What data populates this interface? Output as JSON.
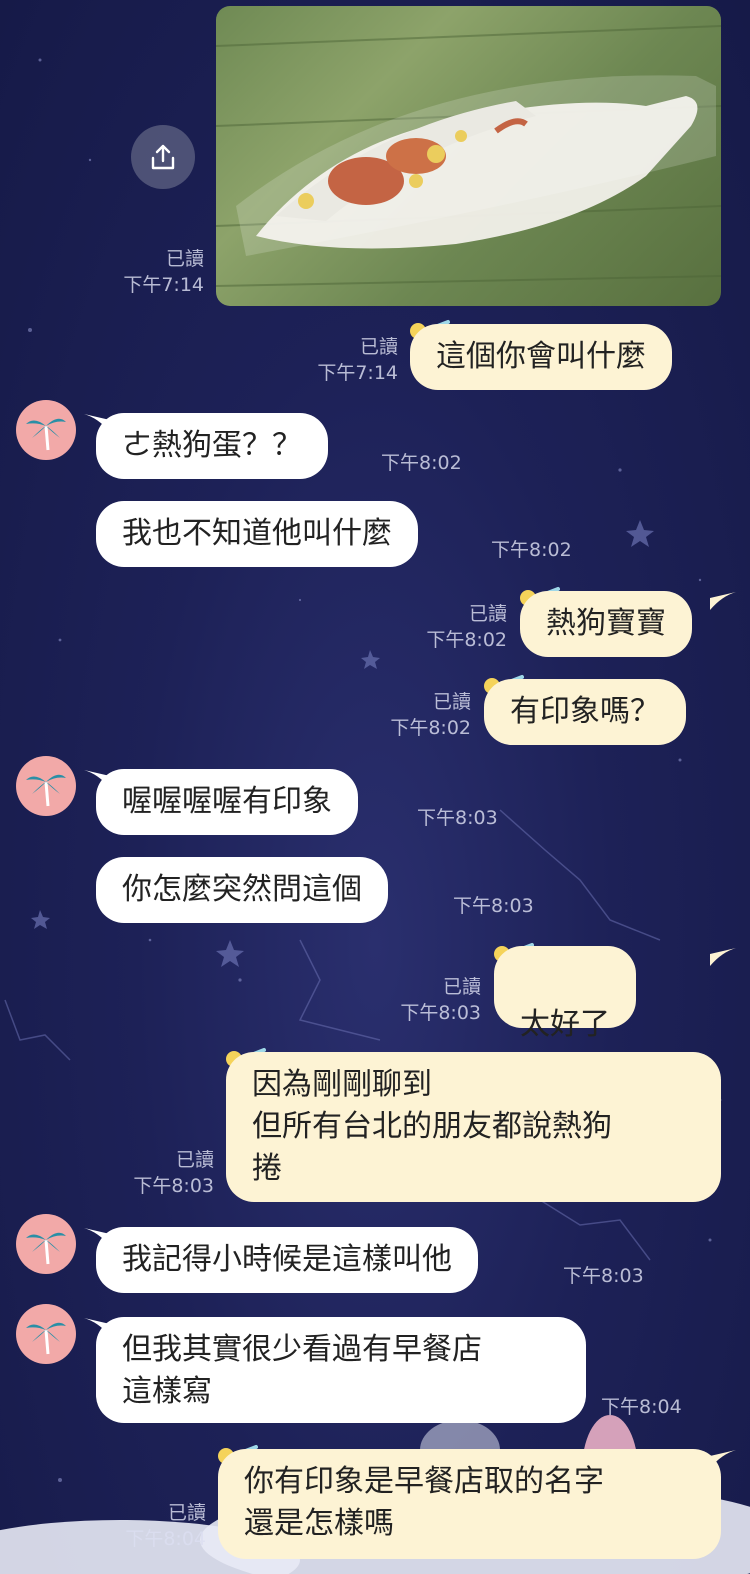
{
  "read_label": "已讀",
  "messages": {
    "m1": {
      "time": "下午7:14"
    },
    "m2": {
      "text": "這個你會叫什麼",
      "time": "下午7:14"
    },
    "m3": {
      "text": "ㄜ熱狗蛋？？",
      "time": "下午8:02"
    },
    "m4": {
      "text": "我也不知道他叫什麼",
      "time": "下午8:02"
    },
    "m5": {
      "text": "熱狗寶寶",
      "time": "下午8:02"
    },
    "m6": {
      "text": "有印象嗎？",
      "time": "下午8:02"
    },
    "m7": {
      "text": "喔喔喔喔有印象",
      "time": "下午8:03"
    },
    "m8": {
      "text": "你怎麼突然問這個",
      "time": "下午8:03"
    },
    "m9": {
      "text": "太好了",
      "time": "下午8:03"
    },
    "m10": {
      "text": "因為剛剛聊到\n但所有台北的朋友都說熱狗\n捲",
      "time": "下午8:03"
    },
    "m11": {
      "text": "我記得小時候是這樣叫他",
      "time": "下午8:03"
    },
    "m12": {
      "text": "但我其實很少看過有早餐店\n這樣寫",
      "time": "下午8:04"
    },
    "m13": {
      "text": "你有印象是早餐店取的名字\n還是怎樣嗎",
      "time": "下午8:04"
    }
  },
  "icons": {
    "share": "share-icon",
    "avatar": "palm-tree-icon",
    "bubble_deco": "shooting-star-icon",
    "sticker": "crying-fox-sticker"
  },
  "colors": {
    "background": "#1d2157",
    "my_bubble": "#fdf3d4",
    "their_bubble": "#ffffff",
    "avatar_bg": "#f2a9a8"
  }
}
